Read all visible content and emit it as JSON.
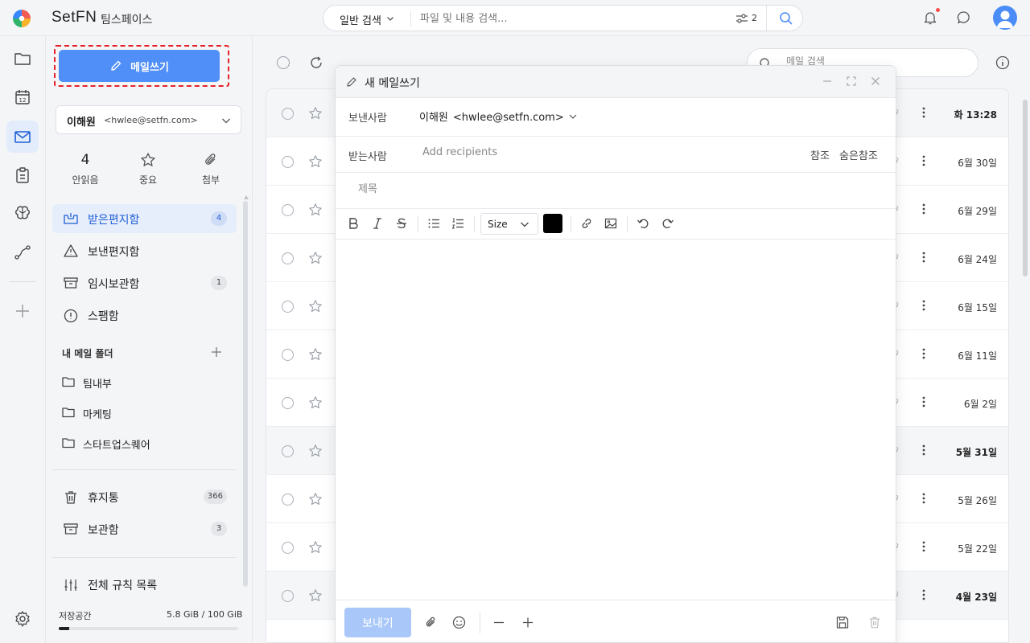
{
  "header": {
    "brand": "SetFN",
    "workspace": "팀스페이스",
    "search_type": "일반 검색",
    "search_placeholder": "파일 및 내용 검색...",
    "filter_count": "2"
  },
  "mailnav": {
    "compose_label": "메일쓰기",
    "account_name": "이해원",
    "account_email": "<hwlee@setfn.com>",
    "stats": [
      {
        "value": "4",
        "label": "안읽음"
      },
      {
        "icon": "star-icon",
        "label": "중요"
      },
      {
        "icon": "paperclip-icon",
        "label": "첨부"
      }
    ],
    "mailboxes": [
      {
        "label": "받은편지함",
        "badge": "4",
        "icon": "inbox-icon"
      },
      {
        "label": "보낸편지함",
        "icon": "sent-icon"
      },
      {
        "label": "임시보관함",
        "badge": "1",
        "icon": "drafts-icon"
      },
      {
        "label": "스팸함",
        "icon": "spam-icon"
      }
    ],
    "folders_header": "내 메일 폴더",
    "folders": [
      "팀내부",
      "마케팅",
      "스타트업스퀘어"
    ],
    "system": [
      {
        "label": "휴지통",
        "badge": "366",
        "icon": "trash-icon"
      },
      {
        "label": "보관함",
        "badge": "3",
        "icon": "archive-icon"
      }
    ],
    "rules_label": "전체 규칙 목록",
    "storage_label": "저장공간",
    "storage_value": "5.8 GiB / 100 GiB",
    "storage_fraction": 0.058
  },
  "list": {
    "search_placeholder": "메일 검색",
    "rows": [
      {
        "date": "화 13:28",
        "unread": true
      },
      {
        "date": "6월 30일",
        "unread": false
      },
      {
        "date": "6월 29일",
        "unread": false
      },
      {
        "date": "6월 24일",
        "unread": false
      },
      {
        "date": "6월 15일",
        "unread": false
      },
      {
        "date": "6월 11일",
        "unread": false
      },
      {
        "date": "6월 2일",
        "unread": false
      },
      {
        "date": "5월 31일",
        "unread": true
      },
      {
        "date": "5월 26일",
        "unread": false
      },
      {
        "date": "5월 22일",
        "unread": false
      },
      {
        "date": "4월 23일",
        "unread": true
      }
    ]
  },
  "compose": {
    "title": "새 메일쓰기",
    "from_label": "보낸사람",
    "from_name": "이해원",
    "from_email": "<hwlee@setfn.com>",
    "to_label": "받는사람",
    "to_placeholder": "Add recipients",
    "cc_label": "참조",
    "bcc_label": "숨은참조",
    "subject_placeholder": "제목",
    "size_label": "Size",
    "text_color": "#000000",
    "send_label": "보내기"
  },
  "colors": {
    "accent": "#4f8ff7",
    "focus_outline": "#e8202a"
  }
}
